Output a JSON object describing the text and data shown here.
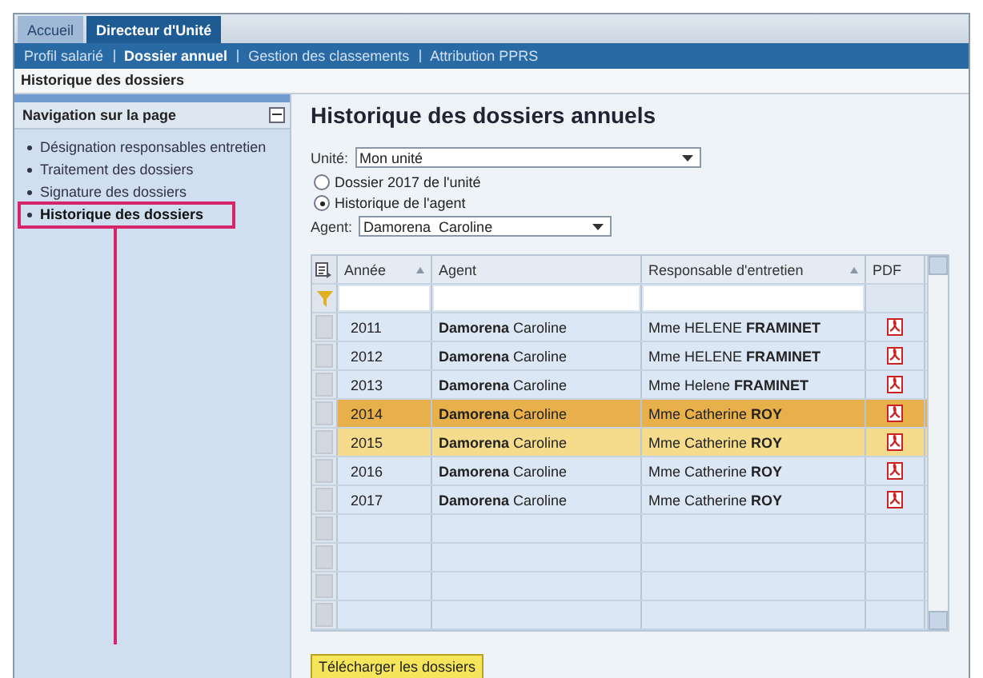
{
  "tabs": [
    {
      "label": "Accueil",
      "selected": false
    },
    {
      "label": "Directeur d'Unité",
      "selected": true
    }
  ],
  "subnav": [
    {
      "label": "Profil salarié",
      "selected": false
    },
    {
      "label": "Dossier annuel",
      "selected": true
    },
    {
      "label": "Gestion des classements",
      "selected": false
    },
    {
      "label": "Attribution PPRS",
      "selected": false
    }
  ],
  "breadcrumb": "Historique des dossiers",
  "sidebar": {
    "title": "Navigation sur la page",
    "items": [
      {
        "label": "Désignation responsables entretien",
        "selected": false,
        "highlighted": false
      },
      {
        "label": "Traitement des dossiers",
        "selected": false,
        "highlighted": false
      },
      {
        "label": "Signature des dossiers",
        "selected": false,
        "highlighted": false
      },
      {
        "label": "Historique des dossiers",
        "selected": true,
        "highlighted": true
      }
    ]
  },
  "page_title": "Historique des dossiers annuels",
  "unit": {
    "label": "Unité:",
    "value": "Mon unité"
  },
  "radios": [
    {
      "label": "Dossier 2017 de l'unité",
      "selected": false
    },
    {
      "label": "Historique de l'agent",
      "selected": true
    }
  ],
  "agent": {
    "label": "Agent:",
    "value": "Damorena  Caroline"
  },
  "table": {
    "columns": [
      "Année",
      "Agent",
      "Responsable d'entretien",
      "PDF"
    ],
    "rows": [
      {
        "year": "2011",
        "agent": "**Damorena** Caroline",
        "manager": "Mme HELENE **FRAMINET**",
        "selected": false,
        "hovered": false
      },
      {
        "year": "2012",
        "agent": "**Damorena** Caroline",
        "manager": "Mme HELENE **FRAMINET**",
        "selected": false,
        "hovered": false
      },
      {
        "year": "2013",
        "agent": "**Damorena** Caroline",
        "manager": "Mme Helene **FRAMINET**",
        "selected": false,
        "hovered": false
      },
      {
        "year": "2014",
        "agent": "**Damorena** Caroline",
        "manager": "Mme Catherine **ROY**",
        "selected": true,
        "hovered": false
      },
      {
        "year": "2015",
        "agent": "**Damorena** Caroline",
        "manager": "Mme Catherine **ROY**",
        "selected": false,
        "hovered": true
      },
      {
        "year": "2016",
        "agent": "**Damorena** Caroline",
        "manager": "Mme Catherine **ROY**",
        "selected": false,
        "hovered": false
      },
      {
        "year": "2017",
        "agent": "**Damorena** Caroline",
        "manager": "Mme Catherine **ROY**",
        "selected": false,
        "hovered": false
      }
    ]
  },
  "download_button": "Télécharger les dossiers"
}
